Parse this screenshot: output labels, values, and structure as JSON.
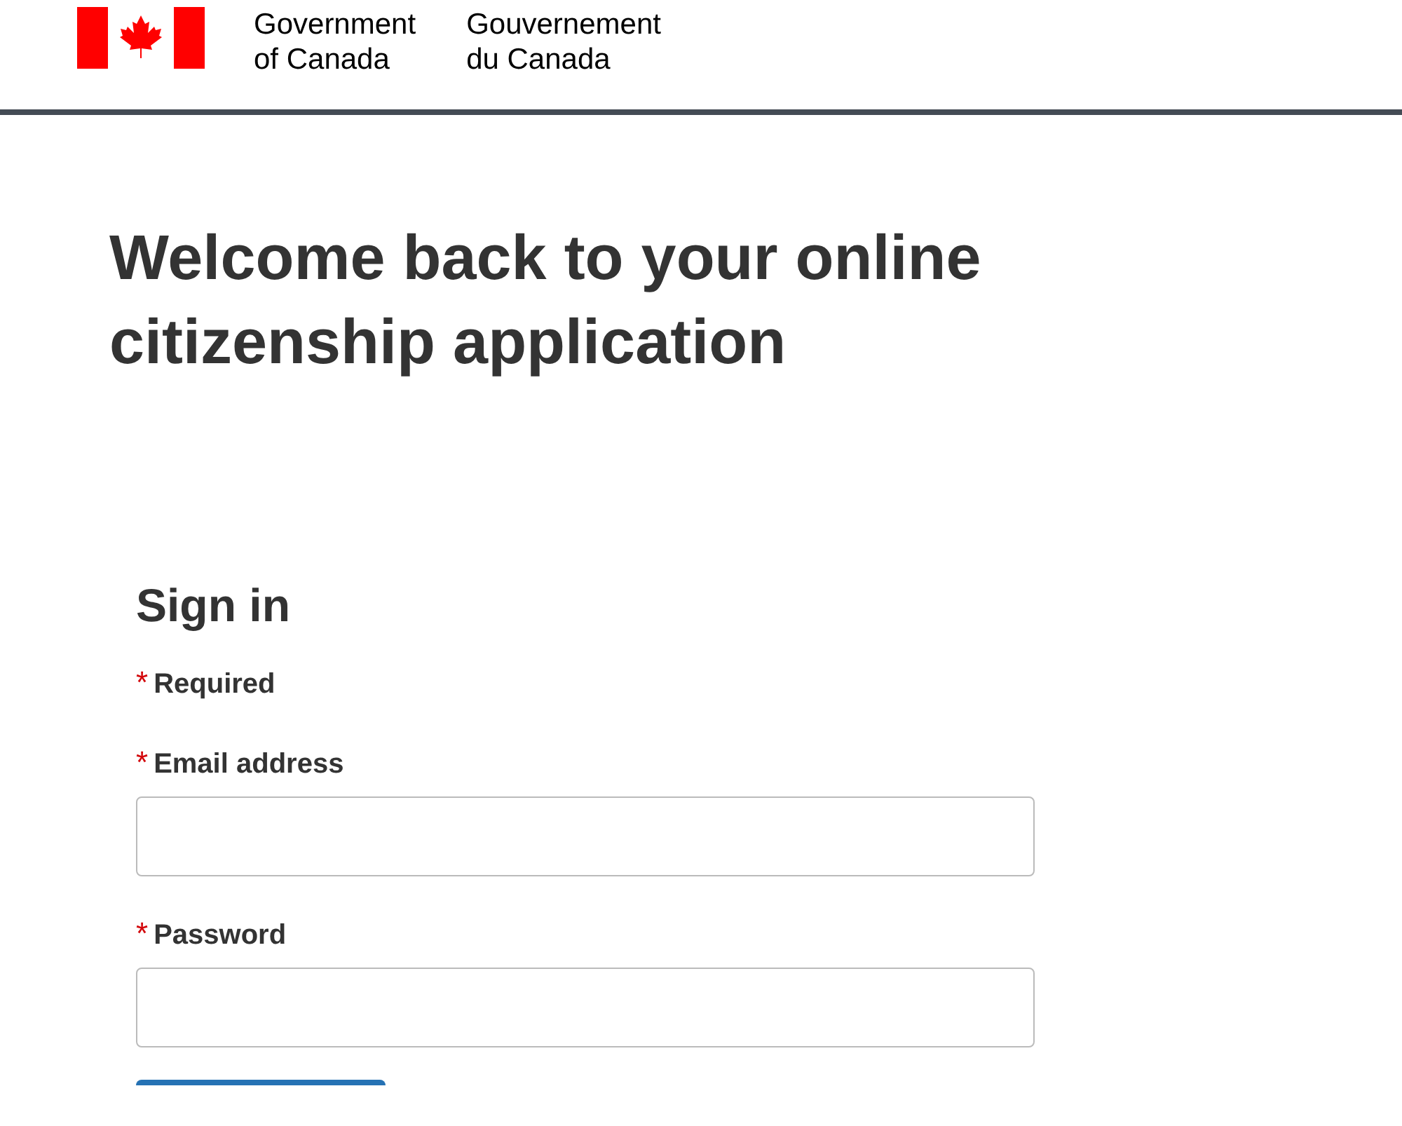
{
  "header": {
    "signature_en": [
      "Government",
      "of Canada"
    ],
    "signature_fr": [
      "Gouvernement",
      "du Canada"
    ]
  },
  "heading": "Welcome back to your online citizenship application",
  "form": {
    "title": "Sign in",
    "legend": {
      "marker": "*",
      "text": "Required"
    },
    "fields": [
      {
        "marker": "*",
        "label": "Email address"
      },
      {
        "marker": "*",
        "label": "Password"
      }
    ],
    "submit": {
      "kind": "primary"
    }
  }
}
